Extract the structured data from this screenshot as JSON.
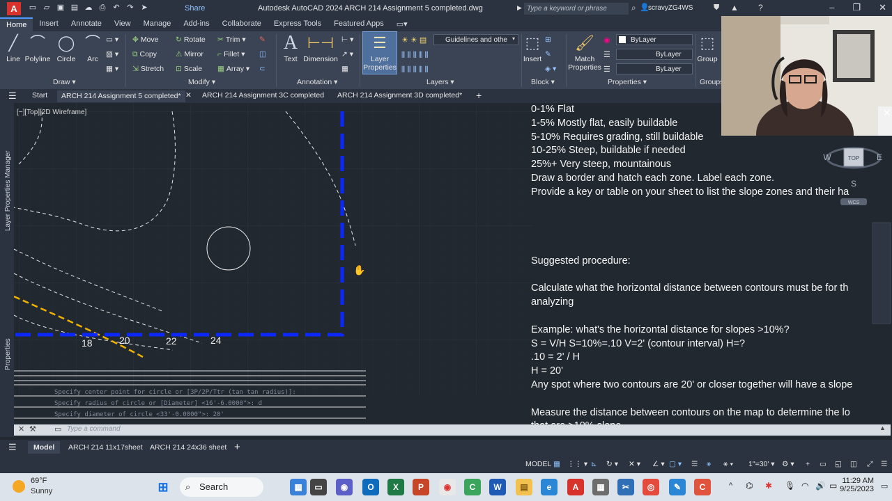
{
  "window": {
    "app_title": "Autodesk AutoCAD 2024    ARCH 214 Assignment 5 completed.dwg",
    "search_placeholder": "Type a keyword or phrase",
    "user": "scravyZG4WS",
    "share": "Share",
    "logo": "A"
  },
  "ribbon_tabs": [
    "Home",
    "Insert",
    "Annotate",
    "View",
    "Manage",
    "Add-ins",
    "Collaborate",
    "Express Tools",
    "Featured Apps"
  ],
  "ribbon": {
    "draw": {
      "line": "Line",
      "polyline": "Polyline",
      "circle": "Circle",
      "arc": "Arc",
      "label": "Draw"
    },
    "modify": {
      "move": "Move",
      "rotate": "Rotate",
      "trim": "Trim",
      "copy": "Copy",
      "mirror": "Mirror",
      "fillet": "Fillet",
      "stretch": "Stretch",
      "scale": "Scale",
      "array": "Array",
      "label": "Modify"
    },
    "annotation": {
      "text": "Text",
      "dimension": "Dimension",
      "label": "Annotation"
    },
    "layers": {
      "layer_properties_1": "Layer",
      "layer_properties_2": "Properties",
      "current_layer": "Guidelines and othe",
      "label": "Layers"
    },
    "block": {
      "insert": "Insert",
      "label": "Block"
    },
    "properties": {
      "match_1": "Match",
      "match_2": "Properties",
      "color": "ByLayer",
      "linetype": "ByLayer",
      "lineweight": "ByLayer",
      "label": "Properties"
    },
    "groups": {
      "group": "Group",
      "label": "Groups"
    }
  },
  "doc_tabs": [
    {
      "label": "Start"
    },
    {
      "label": "ARCH 214 Assignment 5 completed*"
    },
    {
      "label": "ARCH 214 Assignment 3C completed"
    },
    {
      "label": "ARCH 214 Assignment 3D completed*"
    }
  ],
  "viewport": {
    "view_label": "[−][Top][2D Wireframe]",
    "side_layer": "Layer Properties Manager",
    "side_props": "Properties",
    "contour_labels": [
      "18",
      "20",
      "22",
      "24"
    ]
  },
  "note_lines": [
    "0-1% Flat",
    "1-5% Mostly flat, easily buildable",
    "5-10% Requires grading, still buildable",
    "10-25% Steep, buildable if needed",
    "25%+ Very steep, mountainous",
    "Draw a border and hatch each zone. Label each zone.",
    "Provide a key or table on your sheet to list the slope zones and their ha",
    "",
    "",
    "",
    "",
    "Suggested procedure:",
    "",
    "Calculate what the horizontal distance between contours must be for th",
    "analyzing",
    "",
    "Example: what's the horizontal distance for slopes >10%?",
    "S = V/H      S=10%=.10      V=2' (contour interval)   H=?",
    ".10 = 2' / H",
    "H = 20'",
    "Any spot where two contours are 20' or closer together will have a slope",
    "",
    "Measure the distance between contours on the map to determine the lo",
    "that are >10% slope."
  ],
  "viewcube": {
    "top": "TOP",
    "north": "N",
    "south": "S",
    "east": "E",
    "west": "W",
    "wcs": "WCS"
  },
  "command": {
    "history": [
      "Specify center point for circle or [3P/2P/Ttr (tan tan radius)]:",
      "Specify radius of circle or [Diameter] <16'-6.0000\">: d",
      "Specify diameter of circle <33'-0.0000\">: 20'"
    ],
    "placeholder": "Type a command"
  },
  "layout_tabs": [
    "Model",
    "ARCH 214 11x17sheet",
    "ARCH 214 24x36 sheet"
  ],
  "status": {
    "model": "MODEL",
    "scale": "1\"=30'"
  },
  "taskbar": {
    "temp": "69°F",
    "condition": "Sunny",
    "search": "Search",
    "time": "11:29 AM",
    "date": "9/25/2023"
  },
  "colors": {
    "accent": "#4d9bff",
    "border_blue": "#0a28ff",
    "contour_yellow": "#f0b400",
    "ribbon_bg": "#3b4455",
    "canvas_bg": "#212830"
  }
}
